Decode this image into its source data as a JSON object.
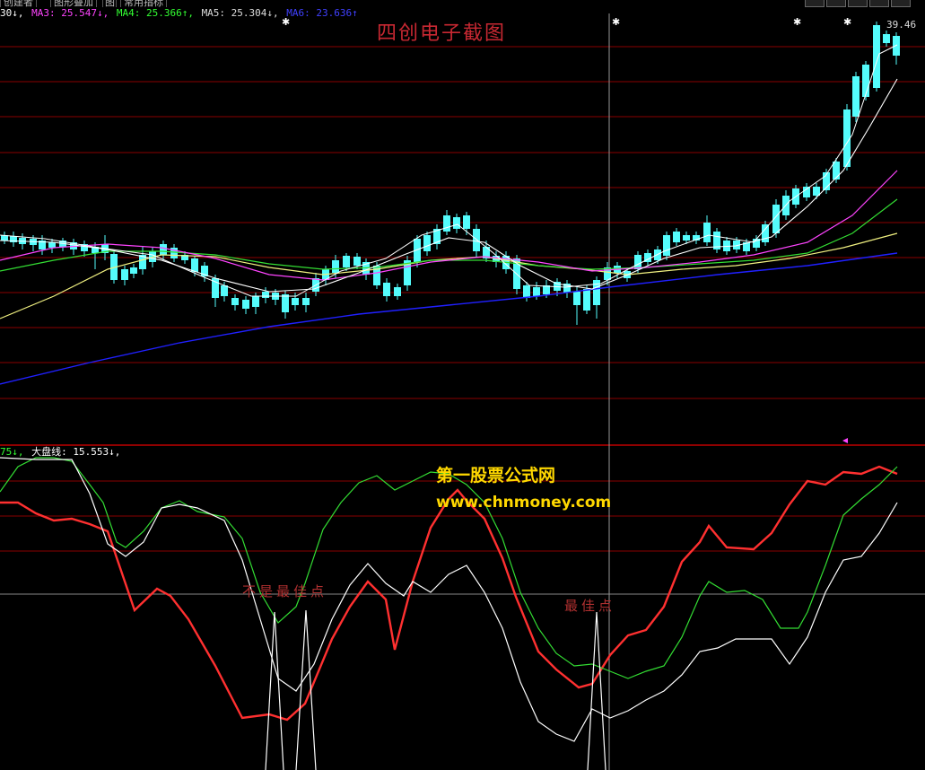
{
  "top_tabs": [
    "创建者",
    "图形叠加",
    "常用指标"
  ],
  "top_bar_glyph": "图",
  "main_legend": {
    "items": [
      {
        "text": "30↓,",
        "color": "#ffffff"
      },
      {
        "text": "MA3: 25.547↓,",
        "color": "#ff44ff"
      },
      {
        "text": "MA4: 25.366↑,",
        "color": "#33ff33"
      },
      {
        "text": "MA5: 25.304↓,",
        "color": "#dddddd"
      },
      {
        "text": "MA6: 23.636↑",
        "color": "#4040ff"
      }
    ]
  },
  "price_label": "39.46",
  "watermark": "四创电子截图",
  "indicator_legend": {
    "items": [
      {
        "text": "75↓,",
        "color": "#33ff33"
      },
      {
        "text": "大盘线: 15.553↓,",
        "color": "#ffffff"
      }
    ]
  },
  "site_name": "第一股票公式网",
  "site_url": "www.chnmoney.com",
  "annotation_1": "不是最佳点",
  "annotation_2": "最佳点",
  "colors": {
    "up": "#ff3030",
    "down": "#54fcfc",
    "ma_white": "#ffffff",
    "ma_yellow": "#f0f080",
    "ma_magenta": "#ff44ff",
    "ma_green": "#33dd33",
    "ma_blue": "#2020ff",
    "grid": "#8a0000",
    "separator": "#c00000"
  }
}
